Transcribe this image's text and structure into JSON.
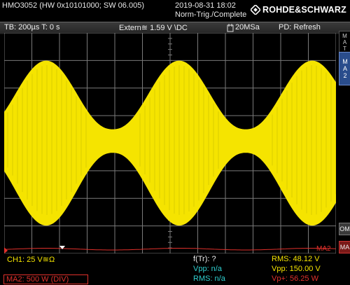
{
  "header": {
    "device": "HMO3052 (HW 0x10101000; SW 06.005)",
    "datetime": "2019-08-31 18:02",
    "trigger_state": "Norm-Trig./Complete",
    "logo_text": "ROHDE&SCHWARZ"
  },
  "status": {
    "timebase": "TB: 200µs  T: 0 s",
    "trigger": "Extern≊ 1.59 V \\DC",
    "sample_rate": "20MSa",
    "pd": "PD: Refresh"
  },
  "side": {
    "math_tab": "MATH",
    "ma2_tab": "MA2",
    "om_btn": "OM",
    "ma_btn": "MA"
  },
  "waveform": {
    "colors": {
      "ch1": "#f5e400",
      "math": "#e0302b",
      "grid": "#7a7a7a",
      "bright": "#d9cc00"
    },
    "marker_ch1": "1",
    "label_ma2": "MA2"
  },
  "readout": {
    "ch1_scale": "CH1: 25 V≊Ω",
    "ma2_scale": "MA2: 500 W (DIV)",
    "freq": "f(Tr): ?",
    "vpp_left": "Vpp: n/a",
    "rms_left": "RMS: n/a",
    "rms_right": "RMS: 48.12 V",
    "vpp_right": "Vpp: 150.00 V",
    "vpplus_right": "Vp+: 56.25 W"
  }
}
